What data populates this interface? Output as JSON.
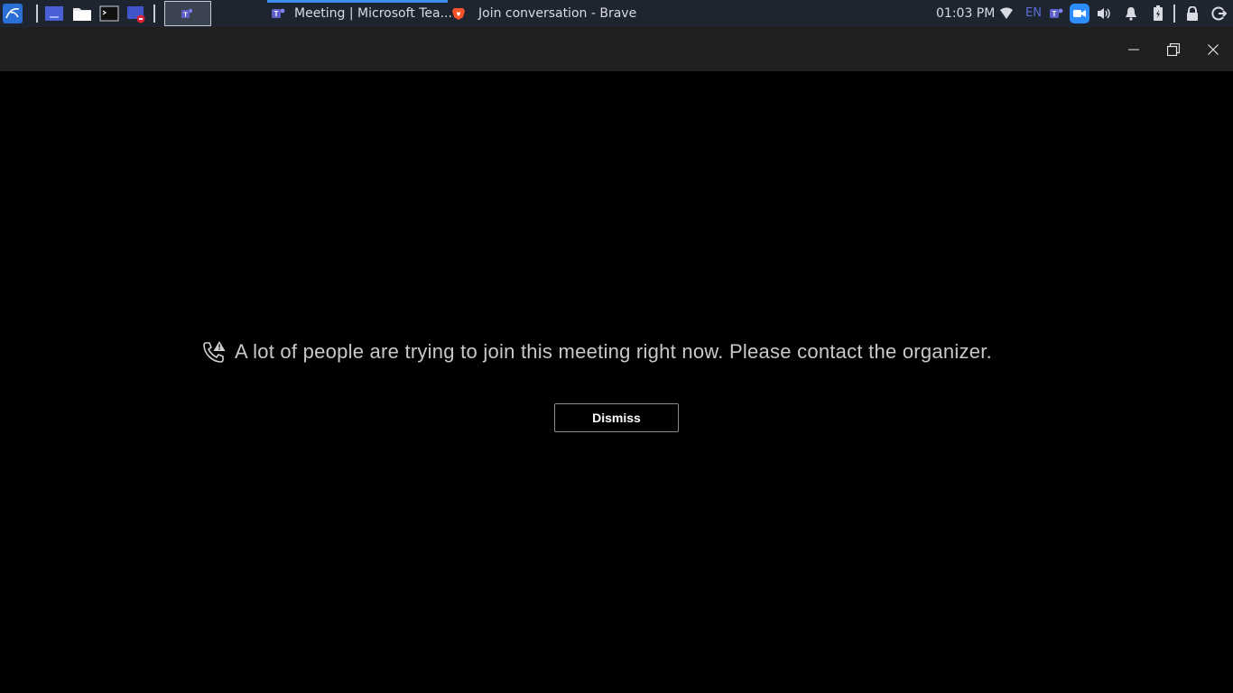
{
  "taskbar": {
    "launchers": [
      {
        "icon": "kali-menu-icon"
      },
      {
        "icon": "desktop-icon"
      },
      {
        "icon": "file-manager-icon"
      },
      {
        "icon": "terminal-icon"
      },
      {
        "icon": "screen-recorder-icon"
      },
      {
        "icon": "teams-icon"
      }
    ],
    "tasks": [
      {
        "label": "Meeting | Microsoft Tea...",
        "icon": "teams-icon",
        "active": true
      },
      {
        "label": "Join conversation - Brave",
        "icon": "brave-icon",
        "active": false
      }
    ],
    "tray": {
      "clock": "01:03 PM",
      "language": "EN"
    }
  },
  "titlebar": {
    "buttons": [
      "minimize-icon",
      "restore-icon",
      "close-icon"
    ]
  },
  "notice": {
    "icon": "call-warning-icon",
    "message": "A lot of people are trying to join this meeting right now. Please contact the organizer.",
    "dismiss_label": "Dismiss"
  },
  "colors": {
    "taskbar_bg": "#1e2430",
    "active_task_accent": "#3d8ef0",
    "titlebar_bg": "#202020",
    "content_bg": "#000000",
    "message_text": "#c8c8c8"
  }
}
